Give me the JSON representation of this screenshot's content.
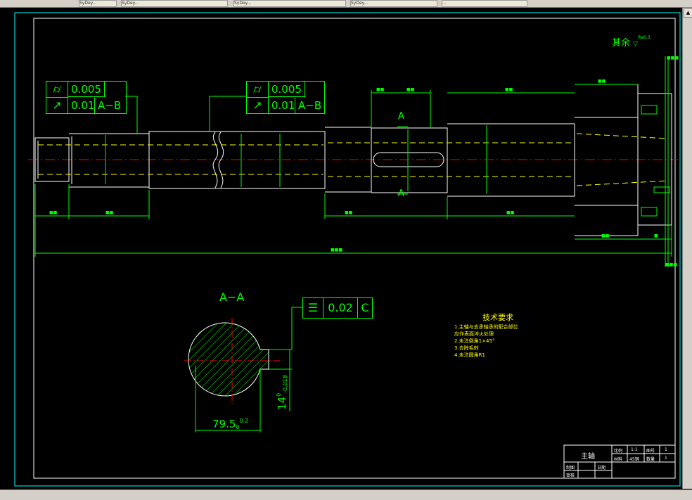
{
  "taskbar": {
    "items": [
      "SyDey...",
      "SyDey...",
      "SyDey...",
      "...",
      "SyDey..."
    ]
  },
  "drawing": {
    "surface_note": "其余",
    "surface_note_ra": "Ra6.3",
    "fcf_top_left": {
      "row1_symbol": "⌭",
      "row1_value": "0.005",
      "row2_symbol": "↗",
      "row2_value": "0.01",
      "row2_datum": "A−B"
    },
    "fcf_top_mid": {
      "row1_symbol": "⌭",
      "row1_value": "0.005",
      "row2_symbol": "↗",
      "row2_value": "0.01",
      "row2_datum": "A−B"
    },
    "fcf_section": {
      "symbol": "☰",
      "value": "0.02",
      "datum": "C"
    },
    "section_label": "A−A",
    "section_marker": "A",
    "dim_width": "79.5",
    "dim_width_tol": "0.2",
    "dim_width_tol_low": "0",
    "dim_depth": "14",
    "dim_depth_tol_high": "0",
    "dim_depth_tol_low": "-0.018",
    "tech_title": "技术要求",
    "tech_items": [
      "1.主轴与支承轴承的配合部位",
      "   应作表面淬火处理",
      "2.未注倒角1×45°",
      "3.去除毛刺",
      "4.未注圆角R1"
    ],
    "titleblock": {
      "name": "主轴",
      "scale_label": "比例",
      "scale": "1:1",
      "sheet_label": "图号",
      "sheet": "1",
      "material_label": "材料",
      "material": "45钢",
      "qty_label": "数量",
      "qty": "1",
      "drawn_label": "制图",
      "check_label": "审核",
      "date_label": "日期"
    }
  },
  "colors": {
    "outline": "#ffffff",
    "green": "#00ff00",
    "red": "#ff0000",
    "yellow": "#ffff00",
    "cyan": "#00ffff",
    "bg": "#000000"
  }
}
